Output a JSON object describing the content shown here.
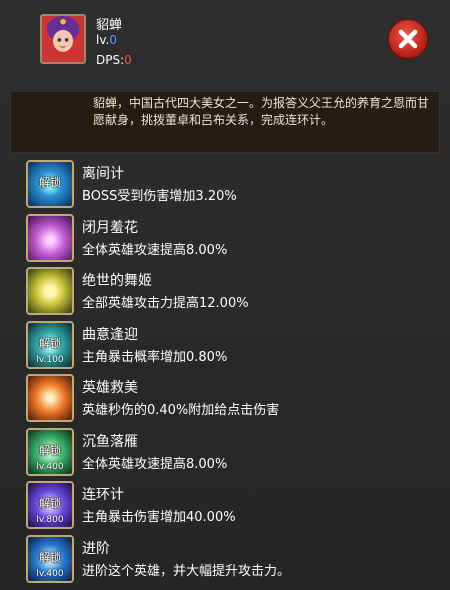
{
  "hero": {
    "name": "貂蝉",
    "level_label": "lv.",
    "level_value": "0",
    "dps_label": "DPS:",
    "dps_value": "0"
  },
  "description": "貂蝉，中国古代四大美女之一。为报答义父王允的养育之恩而甘愿献身，挑拨董卓和吕布关系，完成连环计。",
  "skills": [
    {
      "title": "离间计",
      "effect": "BOSS受到伤害增加3.20%",
      "overlay": "解锁",
      "level": "",
      "icon": "skill-icon-1"
    },
    {
      "title": "闭月羞花",
      "effect": "全体英雄攻速提高8.00%",
      "overlay": "",
      "level": "",
      "icon": "skill-icon-2"
    },
    {
      "title": "绝世的舞姬",
      "effect": "全部英雄攻击力提高12.00%",
      "overlay": "",
      "level": "",
      "icon": "skill-icon-3"
    },
    {
      "title": "曲意逢迎",
      "effect": "主角暴击概率增加0.80%",
      "overlay": "解锁",
      "level": "lv.100",
      "icon": "skill-icon-4"
    },
    {
      "title": "英雄救美",
      "effect": "英雄秒伤的0.40%附加给点击伤害",
      "overlay": "",
      "level": "",
      "icon": "skill-icon-5"
    },
    {
      "title": "沉鱼落雁",
      "effect": "全体英雄攻速提高8.00%",
      "overlay": "解锁",
      "level": "lv.400",
      "icon": "skill-icon-6"
    },
    {
      "title": "连环计",
      "effect": "主角暴击伤害增加40.00%",
      "overlay": "解锁",
      "level": "lv.800",
      "icon": "skill-icon-7"
    },
    {
      "title": "进阶",
      "effect": "进阶这个英雄，并大幅提升攻击力。",
      "overlay": "解锁",
      "level": "lv.400",
      "icon": "skill-icon-8"
    }
  ]
}
